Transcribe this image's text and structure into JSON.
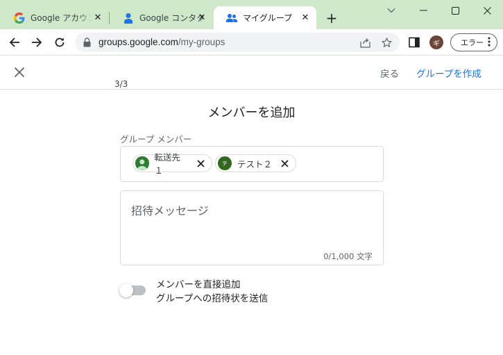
{
  "browser": {
    "tabs": [
      {
        "title": "Google アカウント",
        "icon": "google-g-icon",
        "active": false
      },
      {
        "title": "Google コンタクト",
        "icon": "contacts-person-icon",
        "active": false
      },
      {
        "title": "マイグループ",
        "icon": "groups-people-icon",
        "active": true
      }
    ],
    "url_host": "groups.google.com",
    "url_path": "/my-groups",
    "profile_initial": "ギ",
    "error_label": "エラー"
  },
  "page": {
    "back_label": "戻る",
    "create_label": "グループを作成",
    "step": "3/3",
    "heading": "メンバーを追加",
    "members_label": "グループ メンバー",
    "members": [
      {
        "name": "転送先１",
        "avatar": "person-icon",
        "color": "#2e7d32"
      },
      {
        "name": "テスト２",
        "avatar_initial": "テ",
        "color": "#33691e"
      }
    ],
    "message_placeholder": "招待メッセージ",
    "message_count": "0/1,000 文字",
    "toggle_enabled": false,
    "toggle_label_line1": "メンバーを直接追加",
    "toggle_label_line2": "グループへの招待状を送信"
  },
  "colors": {
    "tabstrip_bg": "#cfe8c9",
    "link_blue": "#1a73e8",
    "border": "#dadce0"
  }
}
